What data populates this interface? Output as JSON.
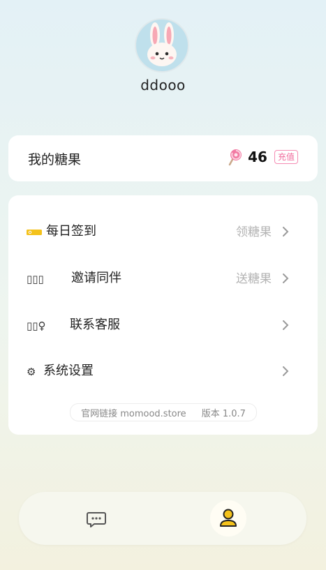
{
  "profile": {
    "username": "ddooo"
  },
  "candy": {
    "title": "我的糖果",
    "count": "46",
    "recharge_label": "充值",
    "icon": "lollipop-icon"
  },
  "menu": [
    {
      "icon": "ticket-icon",
      "label": "每日签到",
      "value": "领糖果"
    },
    {
      "icon": "group-icon",
      "icon_text": "▯▯▯",
      "label": "邀请同伴",
      "value": "送糖果"
    },
    {
      "icon": "support-icon",
      "icon_text": "▯▯♀",
      "label": "联系客服",
      "value": ""
    },
    {
      "icon": "gear-icon",
      "icon_text": "⚙",
      "label": "系统设置",
      "value": ""
    }
  ],
  "footer": {
    "site": "官网链接 momood.store",
    "version": "版本 1.0.7"
  },
  "tabbar": {
    "tabs": [
      {
        "icon": "chat-bubble-icon",
        "active": false
      },
      {
        "icon": "user-icon",
        "active": true
      }
    ]
  },
  "colors": {
    "accent_pink": "#f06b9c",
    "active_tab_yellow": "#f4c21b",
    "muted_text": "#b3b3b3"
  }
}
